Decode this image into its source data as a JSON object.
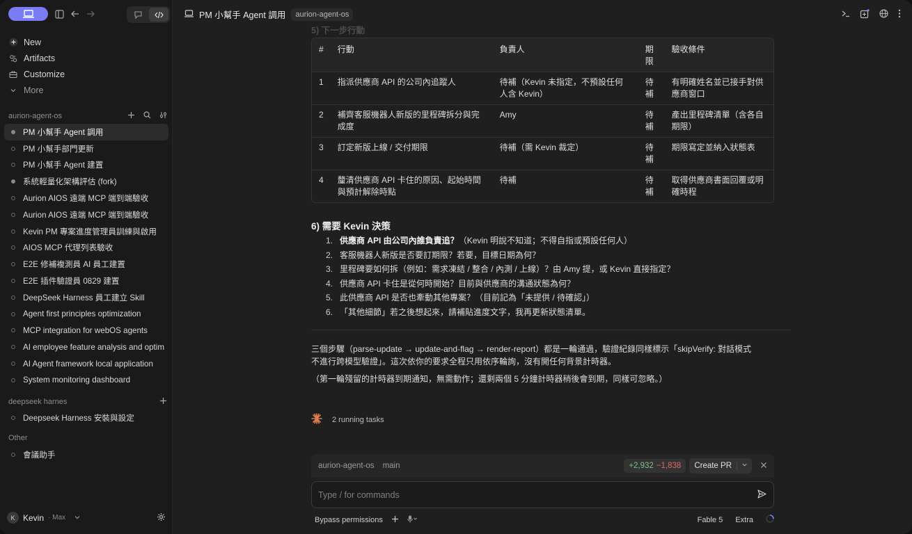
{
  "sidebar": {
    "nav": [
      {
        "label": "New",
        "icon": "plus-icon"
      },
      {
        "label": "Artifacts",
        "icon": "artifacts-icon"
      },
      {
        "label": "Customize",
        "icon": "briefcase-icon"
      },
      {
        "label": "More",
        "icon": "chevron-down-icon"
      }
    ],
    "sections": [
      {
        "title": "aurion-agent-os",
        "items": [
          "PM 小幫手 Agent 調用",
          "PM 小幫手部門更新",
          "PM 小幫手 Agent 建置",
          "系統輕量化架構評估 (fork)",
          "Aurion AIOS 遠端 MCP 端到端驗收",
          "Aurion AIOS 遠端 MCP 端到端驗收",
          "Kevin PM 專案進度管理員訓練與啟用",
          "AIOS MCP 代理列表驗收",
          "E2E 修補複測員 AI 員工建置",
          "E2E 插件驗證員 0829 建置",
          "DeepSeek Harness 員工建立 Skill",
          "Agent first principles optimization",
          "MCP integration for webOS agents",
          "AI employee feature analysis and optim",
          "AI Agent framework local application",
          "System monitoring dashboard"
        ]
      },
      {
        "title": "deepseek harnes",
        "items": [
          "Deepseek Harness 安裝與設定"
        ]
      },
      {
        "title": "Other",
        "items": [
          "會議助手"
        ]
      }
    ],
    "user": {
      "initial": "K",
      "name": "Kevin",
      "plan": "· Max"
    }
  },
  "header": {
    "title": "PM 小幫手 Agent 調用",
    "repo_badge": "aurion-agent-os"
  },
  "content": {
    "section5_title": "5) 下一步行動",
    "table": {
      "headers": [
        "#",
        "行動",
        "負責人",
        "期限",
        "驗收條件"
      ],
      "rows": [
        [
          "1",
          "指派供應商 API 的公司內追蹤人",
          "待補（Kevin 未指定，不預設任何人含 Kevin）",
          "待補",
          "有明確姓名並已接手對供應商窗口"
        ],
        [
          "2",
          "補齊客服機器人新版的里程碑拆分與完成度",
          "Amy",
          "待補",
          "產出里程碑清單（含各自期限）"
        ],
        [
          "3",
          "訂定新版上線 / 交付期限",
          "待補（需 Kevin 裁定）",
          "待補",
          "期限寫定並納入狀態表"
        ],
        [
          "4",
          "釐清供應商 API 卡住的原因、起始時間與預計解除時點",
          "待補",
          "待補",
          "取得供應商書面回覆或明確時程"
        ]
      ]
    },
    "section6_title": "6) 需要 Kevin 決策",
    "decisions": [
      {
        "num": "1.",
        "bold": "供應商 API 由公司內誰負責追？",
        "rest": "（Kevin 明說不知道；不得自指或預設任何人）"
      },
      {
        "num": "2.",
        "bold": "",
        "rest": "客服機器人新版是否要訂期限？若要，目標日期為何？"
      },
      {
        "num": "3.",
        "bold": "",
        "rest": "里程碑要如何拆（例如：需求凍結 / 整合 / 內測 / 上線）？由 Amy 提，或 Kevin 直接指定？"
      },
      {
        "num": "4.",
        "bold": "",
        "rest": "供應商 API 卡住是從何時開始？目前與供應商的溝通狀態為何？"
      },
      {
        "num": "5.",
        "bold": "",
        "rest": "此供應商 API 是否也牽動其他專案？（目前記為「未提供 / 待確認」）"
      },
      {
        "num": "6.",
        "bold": "",
        "rest": "「其他細節」若之後想起來，請補貼進度文字，我再更新狀態清單。"
      }
    ],
    "para1_line1": "三個步驟（parse-update → update-and-flag → render-report）都是一輪通過，驗證紀錄同樣標示「skipVerify: 對話模式",
    "para1_line2": "不進行跨模型驗證」。這次依你的要求全程只用依序輪詢，沒有開任何背景計時器。",
    "para2": "（第一輪殘留的計時器到期通知，無需動作；還剩兩個 5 分鐘計時器稍後會到期，同樣可忽略。）",
    "tasks": "2 running tasks"
  },
  "gitbar": {
    "repo": "aurion-agent-os",
    "branch": "main",
    "additions": "+2,932",
    "deletions": "−1,838",
    "create_pr": "Create PR"
  },
  "composer": {
    "placeholder": "Type / for commands"
  },
  "footer": {
    "permissions": "Bypass permissions",
    "model": "Fable 5",
    "effort": "Extra"
  },
  "colors": {
    "accent": "#7a7cf5",
    "additions": "#7dc383",
    "deletions": "#e06a6a",
    "spark": "#e07a4f"
  }
}
